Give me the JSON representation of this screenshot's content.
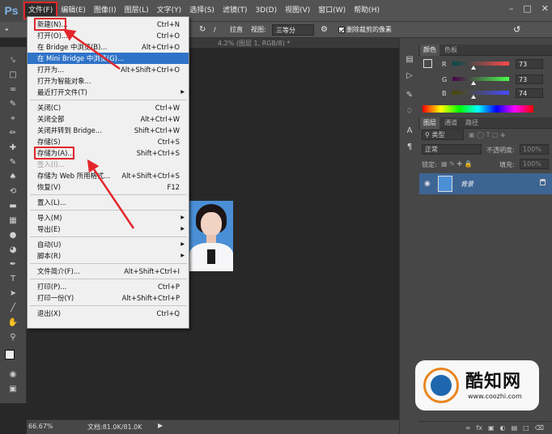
{
  "app": {
    "logo": "Ps"
  },
  "menubar": {
    "items": [
      "文件(F)",
      "编辑(E)",
      "图像(I)",
      "图层(L)",
      "文字(Y)",
      "选择(S)",
      "滤镜(T)",
      "3D(D)",
      "视图(V)",
      "窗口(W)",
      "帮助(H)"
    ],
    "active_index": 0,
    "window_controls": [
      "minimize-icon",
      "restore-icon",
      "close-icon"
    ]
  },
  "options_bar": {
    "straighten": "拉直",
    "view_label": "视图:",
    "view_value": "三等分",
    "delete_cropped": "删除裁剪的像素"
  },
  "document": {
    "tab_text": "4.2% (图层 1, RGB/8) *"
  },
  "status": {
    "zoom": "66.67%",
    "doc_size": "文档:81.0K/81.0K"
  },
  "file_menu": {
    "items": [
      {
        "label": "新建(N)...",
        "shortcut": "Ctrl+N",
        "highlight_box": true
      },
      {
        "label": "打开(O)...",
        "shortcut": "Ctrl+O"
      },
      {
        "label": "在 Bridge 中浏览(B)...",
        "shortcut": "Alt+Ctrl+O"
      },
      {
        "label": "在 Mini Bridge 中浏览(G)...",
        "shortcut": "",
        "hover": true
      },
      {
        "label": "打开为...",
        "shortcut": "Alt+Shift+Ctrl+O"
      },
      {
        "label": "打开为智能对象...",
        "shortcut": ""
      },
      {
        "label": "最近打开文件(T)",
        "shortcut": "",
        "submenu": true
      },
      {
        "separator": true
      },
      {
        "label": "关闭(C)",
        "shortcut": "Ctrl+W"
      },
      {
        "label": "关闭全部",
        "shortcut": "Alt+Ctrl+W"
      },
      {
        "label": "关闭并转到 Bridge...",
        "shortcut": "Shift+Ctrl+W"
      },
      {
        "label": "存储(S)",
        "shortcut": "Ctrl+S"
      },
      {
        "label": "存储为(A)...",
        "shortcut": "Shift+Ctrl+S",
        "highlight_box": true
      },
      {
        "label": "签入(I)...",
        "shortcut": "",
        "disabled": true
      },
      {
        "label": "存储为 Web 所用格式...",
        "shortcut": "Alt+Shift+Ctrl+S"
      },
      {
        "label": "恢复(V)",
        "shortcut": "F12"
      },
      {
        "separator": true
      },
      {
        "label": "置入(L)...",
        "shortcut": ""
      },
      {
        "separator": true
      },
      {
        "label": "导入(M)",
        "shortcut": "",
        "submenu": true
      },
      {
        "label": "导出(E)",
        "shortcut": "",
        "submenu": true
      },
      {
        "separator": true
      },
      {
        "label": "自动(U)",
        "shortcut": "",
        "submenu": true
      },
      {
        "label": "脚本(R)",
        "shortcut": "",
        "submenu": true
      },
      {
        "separator": true
      },
      {
        "label": "文件简介(F)...",
        "shortcut": "Alt+Shift+Ctrl+I"
      },
      {
        "separator": true
      },
      {
        "label": "打印(P)...",
        "shortcut": "Ctrl+P"
      },
      {
        "label": "打印一份(Y)",
        "shortcut": "Alt+Shift+Ctrl+P"
      },
      {
        "separator": true
      },
      {
        "label": "退出(X)",
        "shortcut": "Ctrl+Q"
      }
    ]
  },
  "color_panel": {
    "tabs": [
      "颜色",
      "色板"
    ],
    "channels": [
      {
        "label": "R",
        "value": "73"
      },
      {
        "label": "G",
        "value": "73"
      },
      {
        "label": "B",
        "value": "74"
      }
    ]
  },
  "layers_panel": {
    "tabs": [
      "图层",
      "通道",
      "路径"
    ],
    "filter_kind": "类型",
    "blend_mode": "正常",
    "opacity_label": "不透明度:",
    "opacity_value": "100%",
    "lock_label": "锁定:",
    "fill_label": "填充:",
    "fill_value": "100%",
    "layer_name": "背景"
  },
  "watermark": {
    "brand": "酷知网",
    "url": "www.coozhi.com",
    "accent": "#e8861e",
    "logo_color": "#1e67ae"
  },
  "colors": {
    "annotation_red": "#e2262b",
    "menu_hover": "#2f73c8"
  }
}
